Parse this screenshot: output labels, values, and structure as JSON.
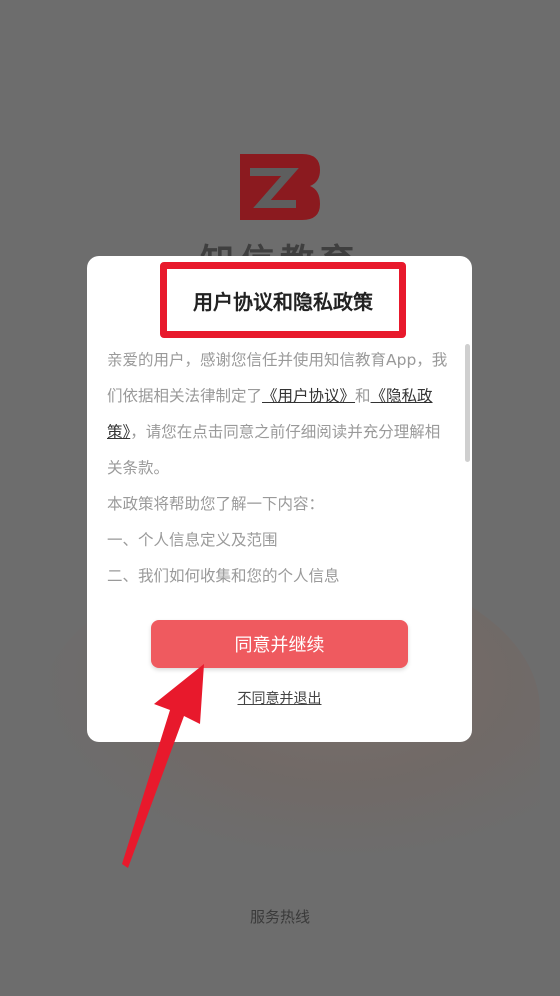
{
  "background": {
    "app_name": "知信教育",
    "hotline_label": "服务热线"
  },
  "dialog": {
    "title": "用户协议和隐私政策",
    "intro_1": "亲爱的用户，感谢您信任并使用知信教育App，我们依据相关法律制定了",
    "link_user_agreement": "《用户协议》",
    "and_text": "和",
    "link_privacy_policy": "《隐私政策》",
    "intro_2": "，请您在点击同意之前仔细阅读并充分理解相关条款。",
    "policy_intro": "本政策将帮助您了解一下内容：",
    "item_1": "一、个人信息定义及范围",
    "item_2": "二、我们如何收集和您的个人信息",
    "agree_button": "同意并继续",
    "disagree_link": "不同意并退出"
  },
  "colors": {
    "overlay": "#6d6d6d",
    "accent_button": "#ef5a5f",
    "highlight_box": "#e8192c",
    "logo": "#8b1a1f",
    "arrow": "#e8192c"
  },
  "icons": {
    "logo": "zb-logo-icon",
    "arrow": "annotation-arrow-icon"
  }
}
